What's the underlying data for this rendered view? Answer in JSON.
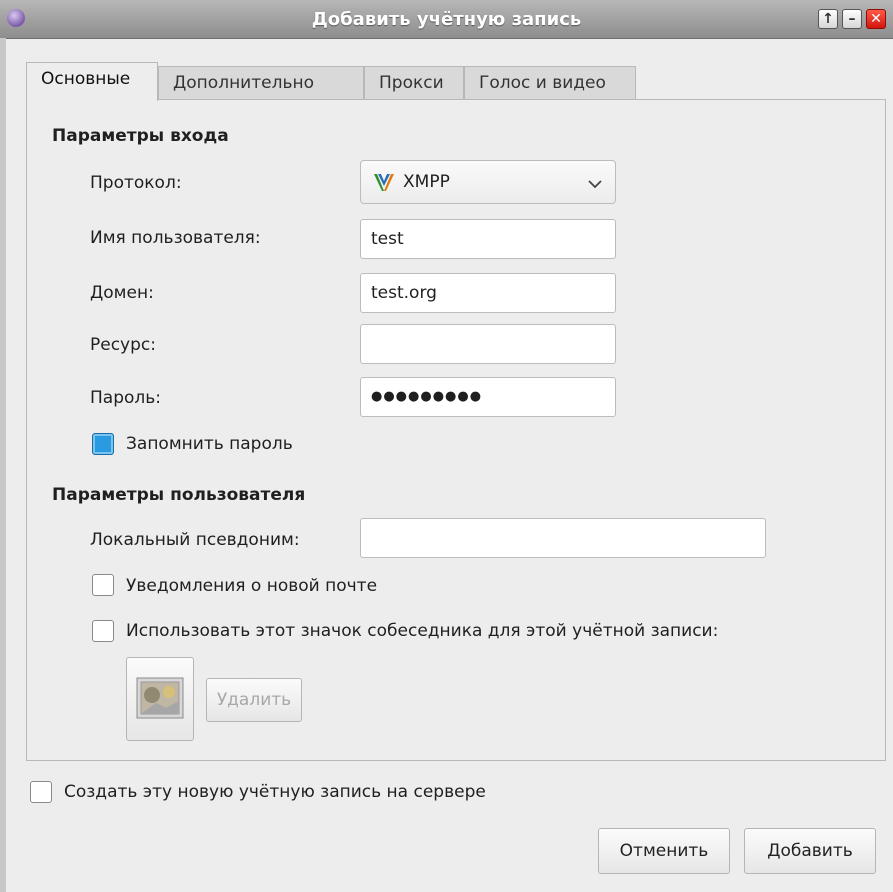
{
  "window": {
    "title": "Добавить учётную запись",
    "icon": "pidgin-app-icon"
  },
  "tabs": [
    {
      "label": "Основные",
      "active": true
    },
    {
      "label": "Дополнительно"
    },
    {
      "label": "Прокси"
    },
    {
      "label": "Голос и видео"
    }
  ],
  "login": {
    "section": "Параметры входа",
    "protocol_label": "Протокол:",
    "protocol_value": "XMPP",
    "username_label": "Имя пользователя:",
    "username_value": "test",
    "domain_label": "Домен:",
    "domain_value": "test.org",
    "resource_label": "Ресурс:",
    "resource_value": "",
    "password_label": "Пароль:",
    "password_value": "●●●●●●●●●",
    "remember_label": "Запомнить пароль",
    "remember_checked": true
  },
  "user": {
    "section": "Параметры пользователя",
    "alias_label": "Локальный псевдоним:",
    "alias_value": "",
    "mail_label": "Уведомления о новой почте",
    "mail_checked": false,
    "buddyicon_label": "Использовать этот значок собеседника для этой учётной записи:",
    "buddyicon_checked": false,
    "remove_label": "Удалить"
  },
  "create_label": "Создать эту новую учётную запись на сервере",
  "buttons": {
    "cancel": "Отменить",
    "add": "Добавить"
  },
  "colors": {
    "accent": "#2a9be0",
    "close": "#d2160d"
  }
}
